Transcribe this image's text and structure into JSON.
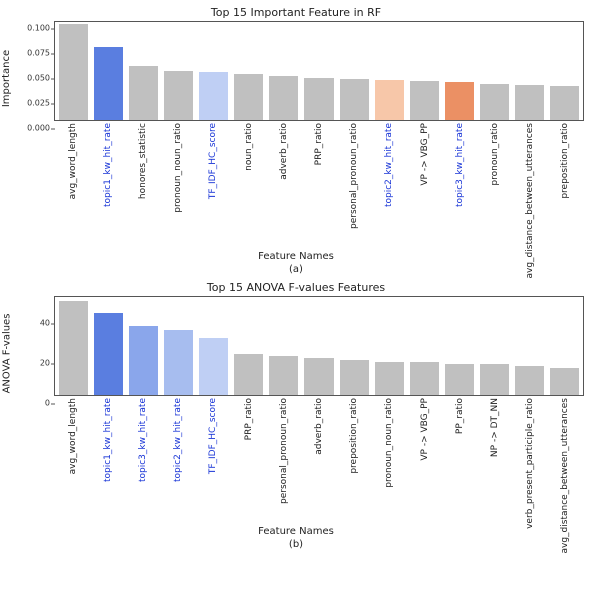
{
  "chart_data": [
    {
      "type": "bar",
      "title": "Top 15 Important Feature in RF",
      "ylabel": "Importance",
      "xlabel": "Feature Names",
      "sublabel": "(a)",
      "ylim": [
        0,
        0.1
      ],
      "yticks": [
        0.0,
        0.025,
        0.05,
        0.075,
        0.1
      ],
      "ytick_labels": [
        "0.000",
        "0.025",
        "0.050",
        "0.075",
        "0.100"
      ],
      "categories": [
        "avg_word_length",
        "topic1_kw_hit_rate",
        "honores_statistic",
        "pronoun_noun_ratio",
        "TF_IDF_HC_score",
        "noun_ratio",
        "adverb_ratio",
        "PRP_ratio",
        "personal_pronoun_ratio",
        "topic2_kw_hit_rate",
        "VP -> VBG_PP",
        "topic3_kw_hit_rate",
        "pronoun_ratio",
        "avg_distance_between_utterances",
        "preposition_ratio"
      ],
      "highlight_idx": [
        1,
        4,
        9,
        11
      ],
      "values": [
        0.098,
        0.075,
        0.055,
        0.05,
        0.049,
        0.047,
        0.045,
        0.043,
        0.042,
        0.041,
        0.04,
        0.039,
        0.037,
        0.036,
        0.035
      ],
      "colors": [
        "grey",
        "blue1",
        "grey",
        "grey",
        "blue4",
        "grey",
        "grey",
        "grey",
        "grey",
        "peach",
        "grey",
        "orange",
        "grey",
        "grey",
        "grey"
      ]
    },
    {
      "type": "bar",
      "title": "Top 15 ANOVA F-values Features",
      "ylabel": "ANOVA F-values",
      "xlabel": "Feature Names",
      "sublabel": "(b)",
      "ylim": [
        0,
        50
      ],
      "yticks": [
        0,
        20,
        40
      ],
      "ytick_labels": [
        "0",
        "20",
        "40"
      ],
      "categories": [
        "avg_word_length",
        "topic1_kw_hit_rate",
        "topic3_kw_hit_rate",
        "topic2_kw_hit_rate",
        "TF_IDF_HC_score",
        "PRP_ratio",
        "personal_pronoun_ratio",
        "adverb_ratio",
        "preposition_ratio",
        "pronoun_noun_ratio",
        "VP -> VBG_PP",
        "PP_ratio",
        "NP -> DT_NN",
        "verb_present_participle_ratio",
        "avg_distance_between_utterances"
      ],
      "highlight_idx": [
        1,
        2,
        3,
        4
      ],
      "values": [
        48,
        42,
        35,
        33,
        29,
        21,
        20,
        19,
        18,
        17,
        17,
        16,
        16,
        15,
        14
      ],
      "colors": [
        "grey",
        "blue1",
        "blue2",
        "blue3",
        "blue4",
        "grey",
        "grey",
        "grey",
        "grey",
        "grey",
        "grey",
        "grey",
        "grey",
        "grey",
        "grey"
      ]
    }
  ]
}
